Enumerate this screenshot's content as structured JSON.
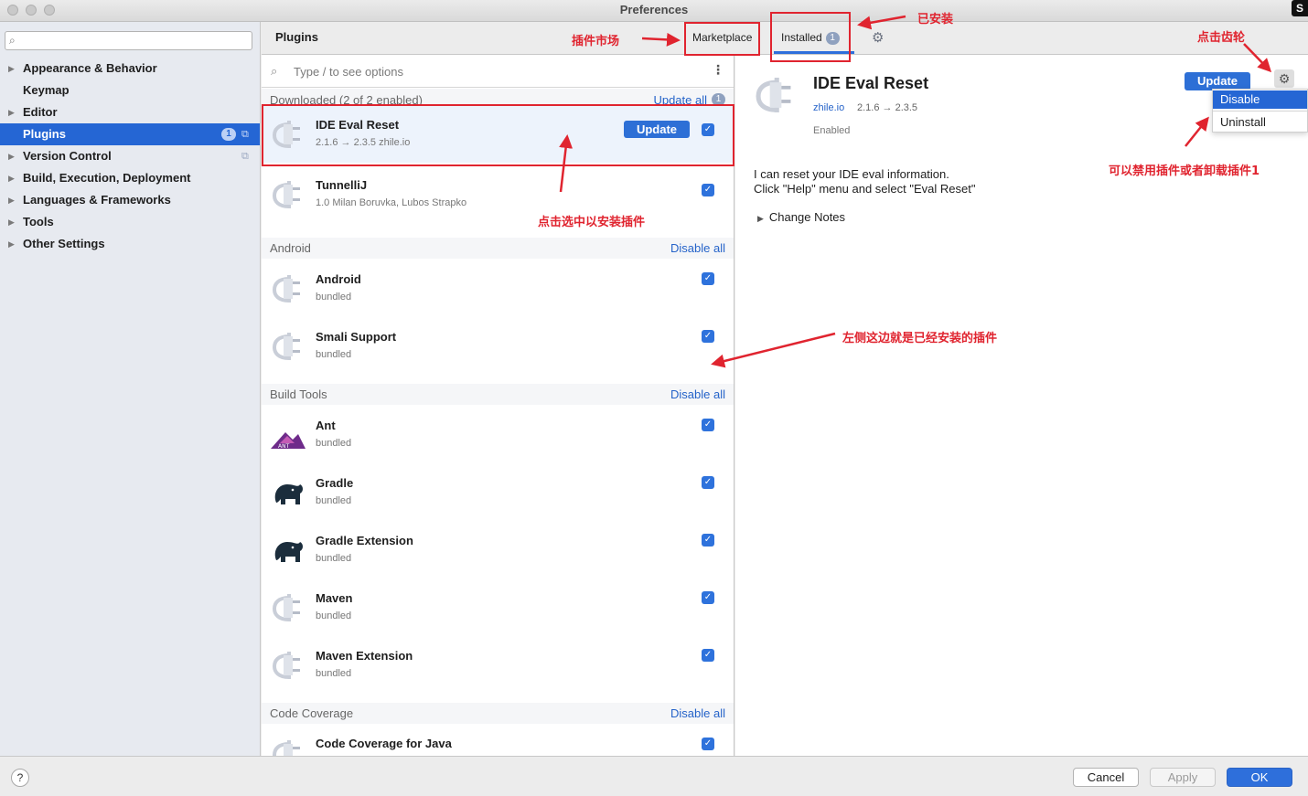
{
  "window": {
    "title": "Preferences",
    "corner_logo": "S"
  },
  "sidebar": {
    "search_placeholder": "",
    "items": [
      {
        "label": "Appearance & Behavior",
        "expandable": true
      },
      {
        "label": "Keymap",
        "expandable": false
      },
      {
        "label": "Editor",
        "expandable": true
      },
      {
        "label": "Plugins",
        "expandable": false,
        "selected": true,
        "badge": "1"
      },
      {
        "label": "Version Control",
        "expandable": true
      },
      {
        "label": "Build, Execution, Deployment",
        "expandable": true
      },
      {
        "label": "Languages & Frameworks",
        "expandable": true
      },
      {
        "label": "Tools",
        "expandable": true
      },
      {
        "label": "Other Settings",
        "expandable": true
      }
    ]
  },
  "header": {
    "title": "Plugins",
    "tabs": [
      {
        "label": "Marketplace"
      },
      {
        "label": "Installed",
        "badge": "1",
        "active": true
      }
    ]
  },
  "list": {
    "search_placeholder": "Type / to see options",
    "groups": [
      {
        "name": "Downloaded (2 of 2 enabled)",
        "action": "Update all",
        "action_badge": "1"
      },
      {
        "name": "Android",
        "action": "Disable all"
      },
      {
        "name": "Build Tools",
        "action": "Disable all"
      },
      {
        "name": "Code Coverage",
        "action": "Disable all"
      }
    ],
    "plugins": [
      {
        "name": "IDE Eval Reset",
        "meta": "2.1.6 → 2.3.5  zhile.io",
        "update": "Update",
        "icon": "plug-icon"
      },
      {
        "name": "TunnelliJ",
        "meta": "1.0  Milan Boruvka, Lubos Strapko",
        "icon": "plug-icon"
      },
      {
        "name": "Android",
        "meta": "bundled",
        "icon": "plug-icon"
      },
      {
        "name": "Smali Support",
        "meta": "bundled",
        "icon": "plug-icon"
      },
      {
        "name": "Ant",
        "meta": "bundled",
        "icon": "ant-icon"
      },
      {
        "name": "Gradle",
        "meta": "bundled",
        "icon": "elephant-icon"
      },
      {
        "name": "Gradle Extension",
        "meta": "bundled",
        "icon": "elephant-icon"
      },
      {
        "name": "Maven",
        "meta": "bundled",
        "icon": "plug-icon"
      },
      {
        "name": "Maven Extension",
        "meta": "bundled",
        "icon": "plug-icon"
      },
      {
        "name": "Code Coverage for Java",
        "meta": "",
        "icon": "plug-icon"
      }
    ]
  },
  "detail": {
    "title": "IDE Eval Reset",
    "vendor": "zhile.io",
    "version": "2.1.6 → 2.3.5",
    "status": "Enabled",
    "update": "Update",
    "desc_line1": "I can reset your IDE eval information.",
    "desc_line2": "Click \"Help\" menu and select \"Eval Reset\"",
    "change_notes": "Change Notes",
    "menu": {
      "disable": "Disable",
      "uninstall": "Uninstall"
    }
  },
  "footer": {
    "help": "?",
    "cancel": "Cancel",
    "apply": "Apply",
    "ok": "OK"
  },
  "annotations": {
    "marketplace": "插件市场",
    "installed": "已安装",
    "gear": "点击齿轮",
    "select": "点击选中以安装插件",
    "installed_list": "左侧这边就是已经安装的插件",
    "disable_uninstall": "可以禁用插件或者卸载插件1"
  },
  "colors": {
    "accent": "#2566d4",
    "annotation": "#e0242f"
  }
}
